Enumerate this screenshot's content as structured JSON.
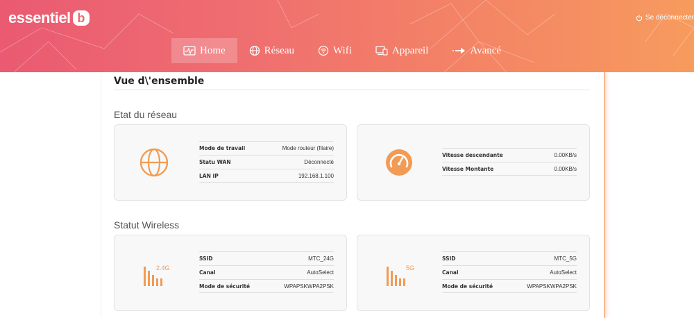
{
  "header": {
    "logo_text": "essentiel",
    "logo_mark": "b",
    "logout_label": "Se déconnecter",
    "logout_icon": "power-icon",
    "gradient": [
      "#ea5a72",
      "#f79b5e"
    ]
  },
  "nav": {
    "items": [
      {
        "label": "Home",
        "icon": "monitor-pulse-icon",
        "active": true
      },
      {
        "label": "Réseau",
        "icon": "globe-icon",
        "active": false
      },
      {
        "label": "Wifi",
        "icon": "wifi-icon",
        "active": false
      },
      {
        "label": "Appareil",
        "icon": "devices-icon",
        "active": false
      },
      {
        "label": "Avancé",
        "icon": "arrow-right-icon",
        "active": false
      }
    ]
  },
  "page": {
    "title": "Vue d\\'ensemble",
    "accent_color": "#f29b54"
  },
  "network_status": {
    "title": "Etat du réseau",
    "connection": {
      "icon": "globe-icon",
      "rows": [
        {
          "label": "Mode de travail",
          "value": "Mode routeur (filaire)"
        },
        {
          "label": "Statu WAN",
          "value": "Déconnecté"
        },
        {
          "label": "LAN IP",
          "value": "192.168.1.100"
        }
      ]
    },
    "speed": {
      "icon": "speedometer-icon",
      "rows": [
        {
          "label": "Vitesse descendante",
          "value": "0.00KB/s"
        },
        {
          "label": "Vitesse Montante",
          "value": "0.00KB/s"
        }
      ]
    }
  },
  "wireless_status": {
    "title": "Statut Wireless",
    "bands": [
      {
        "band": "2.4G",
        "icon": "signal-bars-icon",
        "rows": [
          {
            "label": "SSID",
            "value": "MTC_24G"
          },
          {
            "label": "Canal",
            "value": "AutoSelect"
          },
          {
            "label": "Mode de sécurité",
            "value": "WPAPSKWPA2PSK"
          }
        ]
      },
      {
        "band": "5G",
        "icon": "signal-bars-icon",
        "rows": [
          {
            "label": "SSID",
            "value": "MTC_5G"
          },
          {
            "label": "Canal",
            "value": "AutoSelect"
          },
          {
            "label": "Mode de sécurité",
            "value": "WPAPSKWPA2PSK"
          }
        ]
      }
    ]
  }
}
